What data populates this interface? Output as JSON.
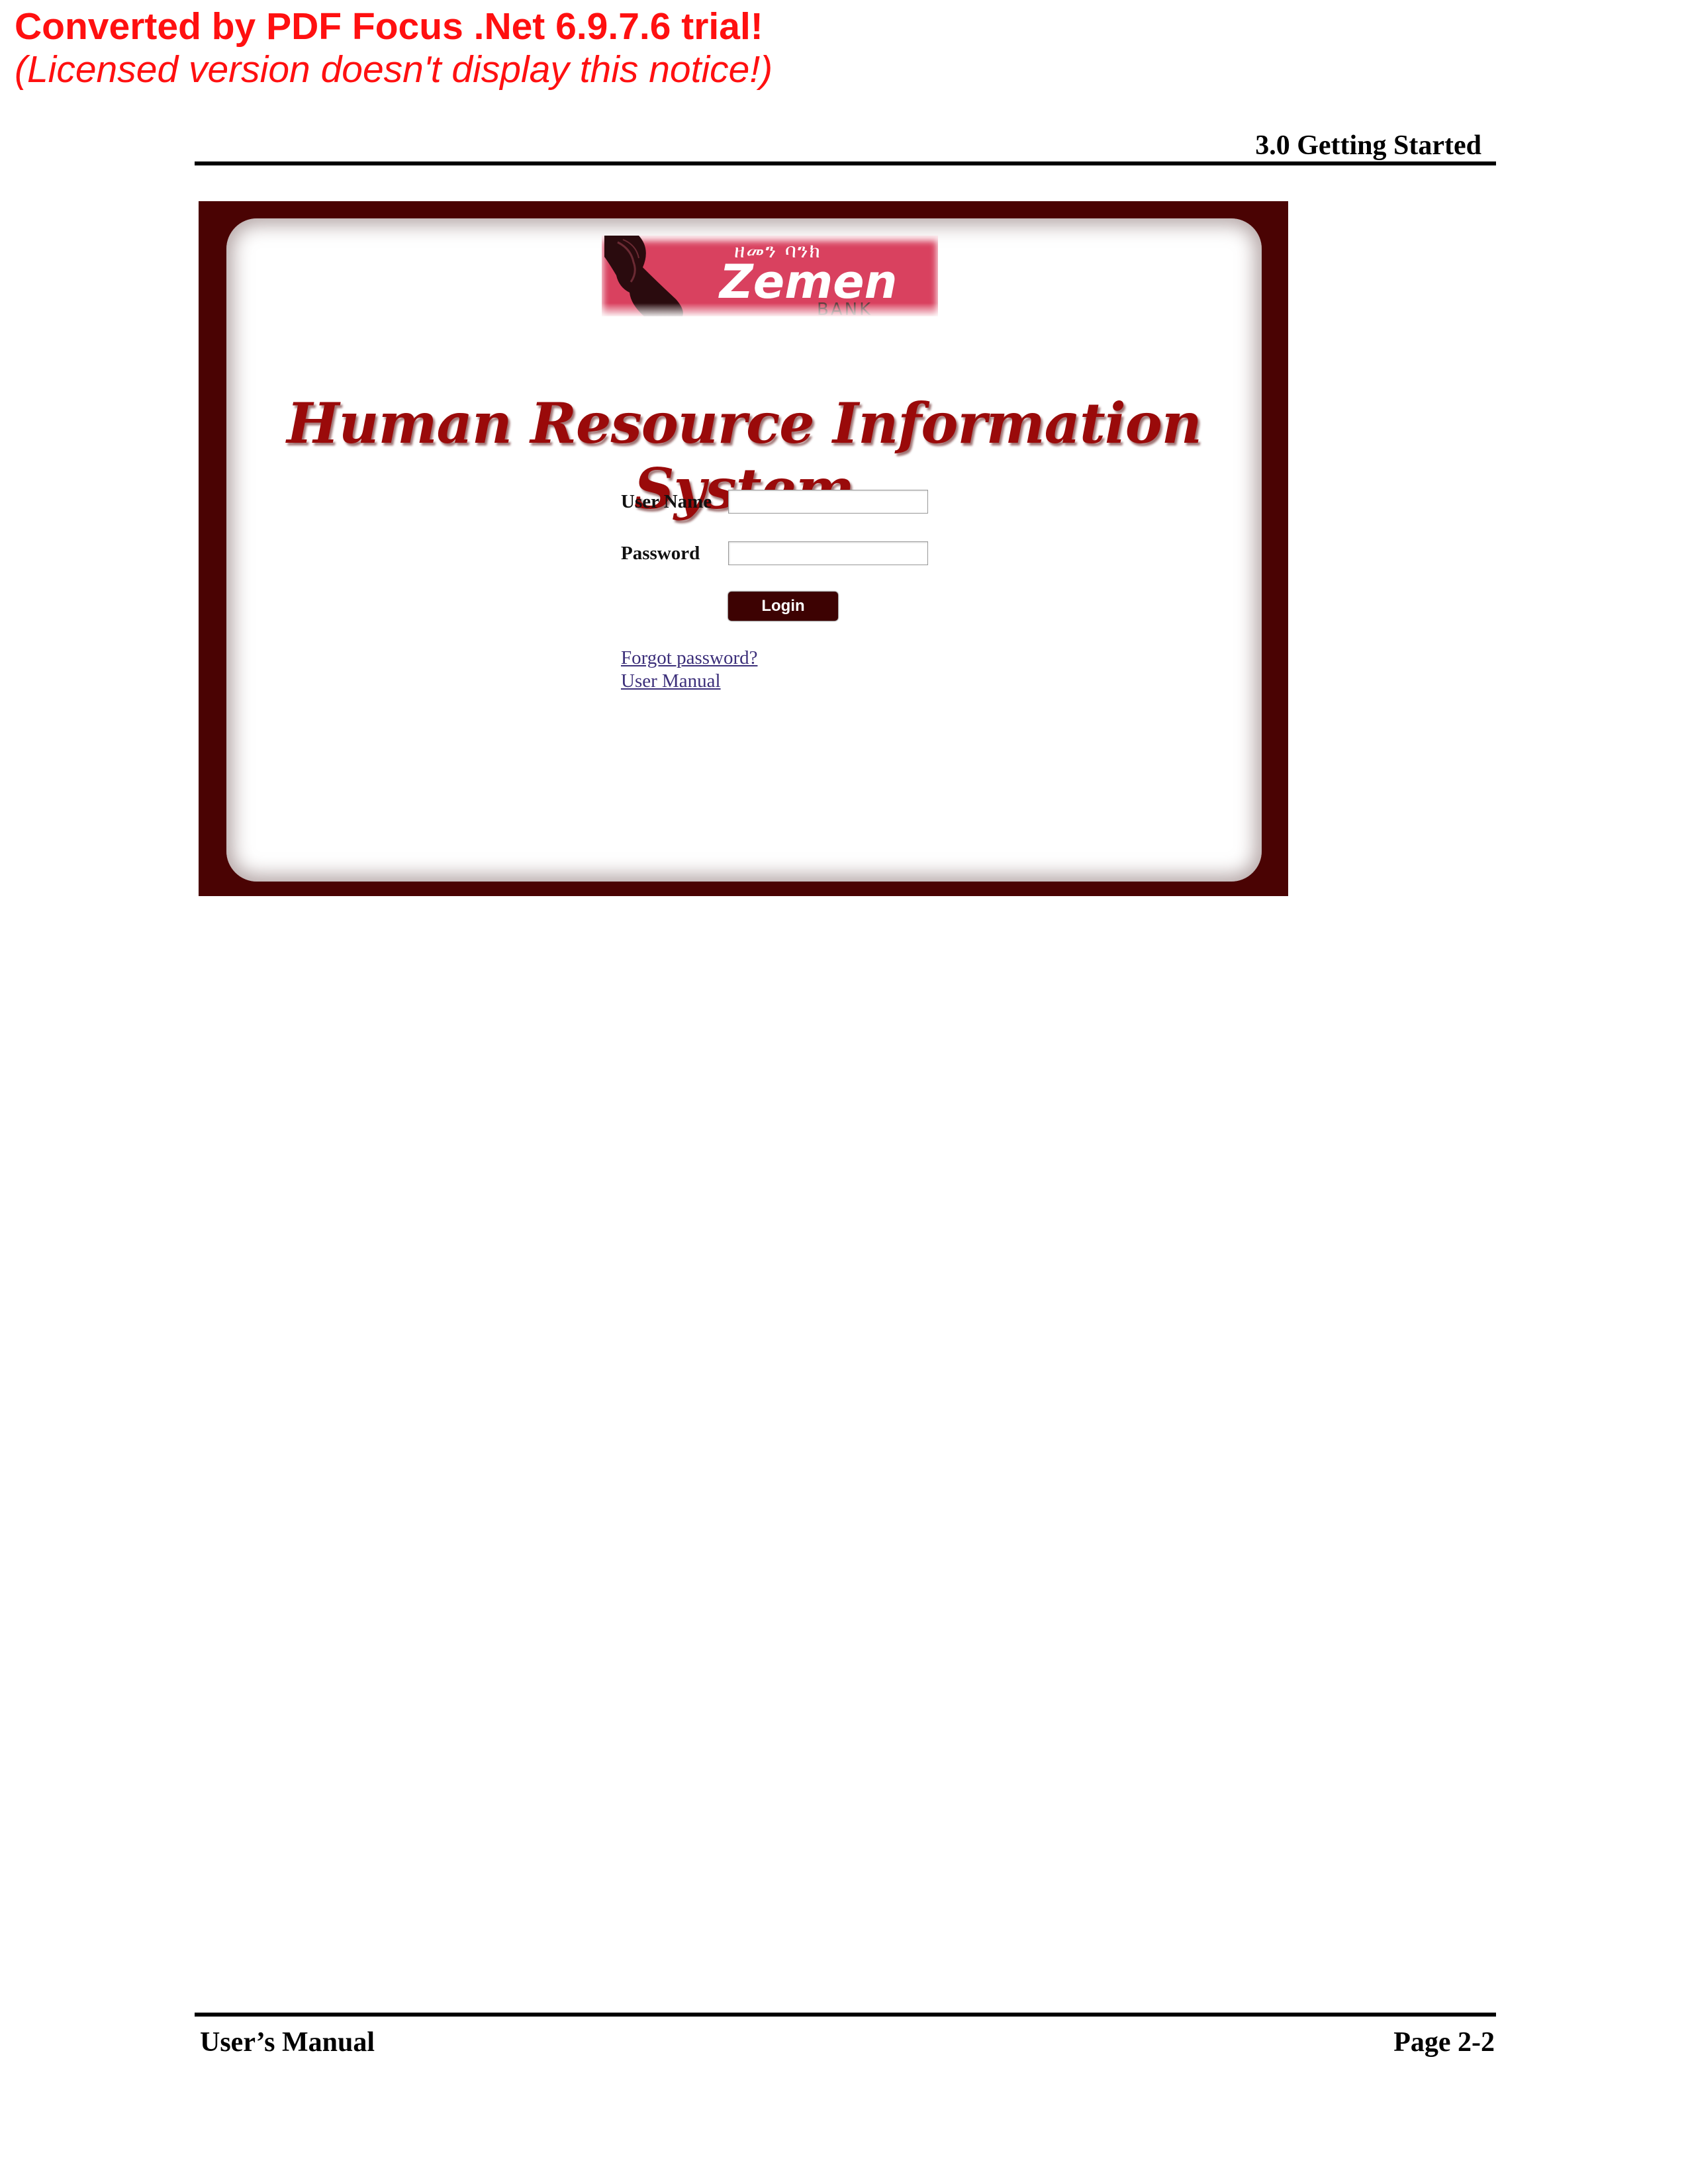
{
  "watermark": {
    "line1": "Converted by PDF Focus .Net 6.9.7.6 trial!",
    "line2": "(Licensed version doesn't display this notice!)"
  },
  "header": {
    "section_title": "3.0  Getting Started"
  },
  "screenshot": {
    "logo": {
      "amharic_text": "ዘመን ባንክ",
      "brand_text": "Zemen",
      "bank_text": "BANK",
      "bird_icon": "bird-silhouette-icon"
    },
    "title": "Human Resource Information System",
    "form": {
      "username_label": "User Name",
      "username_value": "",
      "password_label": "Password",
      "password_value": "",
      "login_label": "Login"
    },
    "links": {
      "forgot_password": "Forgot password?",
      "user_manual": "User Manual"
    },
    "colors": {
      "frame": "#4a0303",
      "logo_background": "#d9415f",
      "title": "#9a0a0a",
      "button": "#3d0202",
      "link": "#3c2f7a"
    }
  },
  "footer": {
    "left": "User’s Manual",
    "right": "Page 2-2"
  }
}
